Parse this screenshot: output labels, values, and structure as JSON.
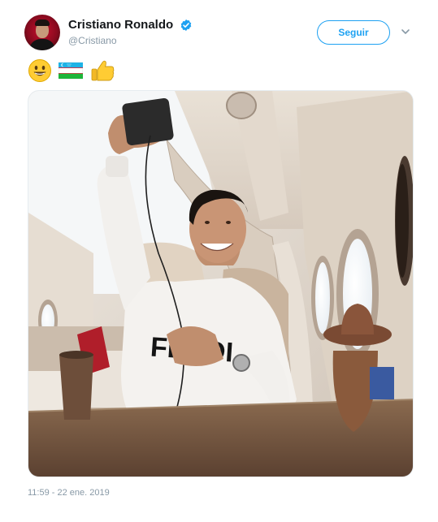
{
  "tweet": {
    "author": {
      "display_name": "Cristiano Ronaldo",
      "handle": "@Cristiano",
      "verified": true,
      "avatar_icon": "profile-photo"
    },
    "follow_button_label": "Seguir",
    "more_icon": "chevron-down-icon",
    "emojis": [
      "grinning-face",
      "flag-uzbekistan",
      "thumbs-up"
    ],
    "photo": {
      "sweater_text": "FENDI"
    },
    "timestamp": "11:59 - 22 ene. 2019"
  },
  "colors": {
    "accent": "#1da1f2",
    "text_primary": "#14171a",
    "text_secondary": "#8899a6"
  }
}
